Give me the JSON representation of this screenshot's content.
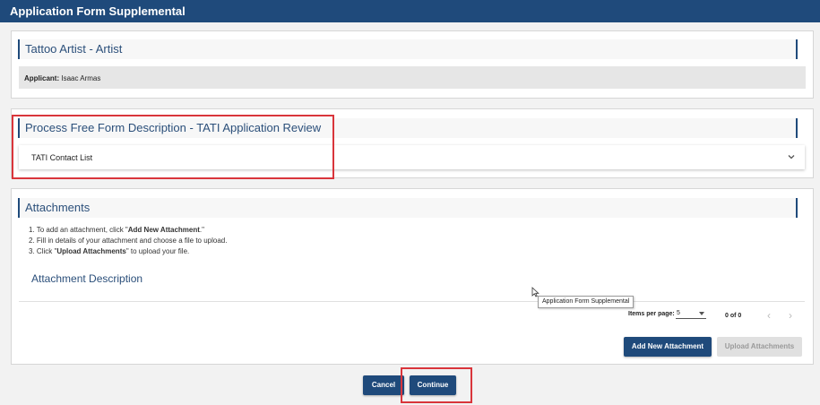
{
  "window": {
    "title": "Application Form Supplemental"
  },
  "license_section": {
    "title": "Tattoo Artist - Artist",
    "applicant_label": "Applicant:",
    "applicant_name": "Isaac Armas"
  },
  "process_section": {
    "title": "Process Free Form Description - TATI Application Review",
    "items": [
      {
        "label": "TATI Contact List"
      }
    ]
  },
  "attachments_section": {
    "title": "Attachments",
    "instructions": [
      {
        "num": "1.",
        "pre": "To add an attachment, click \"",
        "bold": "Add New Attachment",
        "post": ".\""
      },
      {
        "num": "2.",
        "pre": "Fill in details of your attachment and choose a file to upload.",
        "bold": "",
        "post": ""
      },
      {
        "num": "3.",
        "pre": "Click \"",
        "bold": "Upload Attachments",
        "post": "\" to upload your file."
      }
    ],
    "description_heading": "Attachment Description",
    "tooltip": "Application Form Supplemental",
    "items_per_page_label": "Items per page:",
    "items_per_page_value": "5",
    "range": "0 of 0",
    "prev_icon": "chevron-left-icon",
    "next_icon": "chevron-right-icon",
    "add_button": "Add New Attachment",
    "upload_button": "Upload Attachments"
  },
  "footer": {
    "cancel_button": "Cancel",
    "continue_button": "Continue"
  },
  "colors": {
    "brand": "#1f4a7b",
    "highlight": "#d9353b",
    "disabled": "#e0e0e0"
  }
}
